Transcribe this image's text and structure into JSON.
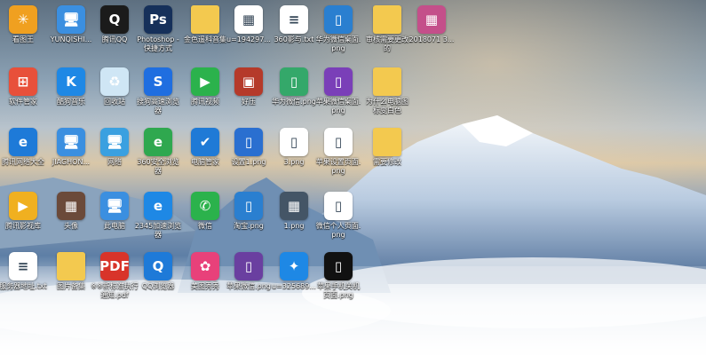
{
  "desktop": {
    "icons": [
      {
        "label": "看图王",
        "glyph": "✳",
        "color": "#f0a020",
        "icon": "kantu-icon"
      },
      {
        "label": "YUNQISHI...",
        "glyph": "🖥",
        "color": "#3b8fe0",
        "icon": "computer-icon"
      },
      {
        "label": "腾讯QQ",
        "glyph": "Q",
        "color": "#1b1b1b",
        "icon": "qq-icon"
      },
      {
        "label": "Photoshop - 快捷方式",
        "glyph": "Ps",
        "color": "#16305a",
        "icon": "photoshop-icon"
      },
      {
        "label": "金色遥科音集",
        "glyph": "",
        "color": "#f3c94f",
        "icon": "folder-icon"
      },
      {
        "label": "u=194297...",
        "glyph": "▦",
        "color": "#ffffff",
        "icon": "image-file-icon"
      },
      {
        "label": "360影与.txt",
        "glyph": "≡",
        "color": "#ffffff",
        "icon": "text-file-icon"
      },
      {
        "label": "华为微信桌面.png",
        "glyph": "▯",
        "color": "#2a7fd0",
        "icon": "phone-image-icon"
      },
      {
        "label": "审核需要更改的",
        "glyph": "",
        "color": "#f3c94f",
        "icon": "folder-icon"
      },
      {
        "label": "2018071 3...",
        "glyph": "▦",
        "color": "#c44f8a",
        "icon": "image-file-icon"
      },
      {
        "label": "软件管家",
        "glyph": "⊞",
        "color": "#e8503a",
        "icon": "software-manager-icon"
      },
      {
        "label": "酷狗音乐",
        "glyph": "K",
        "color": "#1e88e5",
        "icon": "kugou-icon"
      },
      {
        "label": "回收站",
        "glyph": "♻",
        "color": "#cfe6f5",
        "icon": "recycle-bin-icon"
      },
      {
        "label": "搜狗高速浏览器",
        "glyph": "S",
        "color": "#1f6ee0",
        "icon": "sogou-browser-icon"
      },
      {
        "label": "腾讯视频",
        "glyph": "▶",
        "color": "#2bb24c",
        "icon": "tencent-video-icon"
      },
      {
        "label": "好压",
        "glyph": "▣",
        "color": "#b53a2a",
        "icon": "haozip-icon"
      },
      {
        "label": "华为微信.png",
        "glyph": "▯",
        "color": "#34a86a",
        "icon": "phone-image-icon"
      },
      {
        "label": "苹果微信桌面.png",
        "glyph": "▯",
        "color": "#7a3fb8",
        "icon": "phone-image-icon"
      },
      {
        "label": "为什么电脑图标变白色",
        "glyph": "",
        "color": "#f3c94f",
        "icon": "folder-icon"
      },
      {
        "label": "腾讯网络大全",
        "glyph": "e",
        "color": "#1e7ad8",
        "icon": "ie-icon"
      },
      {
        "label": "JIAGHON...",
        "glyph": "🖥",
        "color": "#3b8fe0",
        "icon": "computer-icon"
      },
      {
        "label": "网络",
        "glyph": "🖥",
        "color": "#3aa0e0",
        "icon": "network-icon"
      },
      {
        "label": "360安全浏览器",
        "glyph": "e",
        "color": "#2fa84f",
        "icon": "360-browser-icon"
      },
      {
        "label": "电脑管家",
        "glyph": "✔",
        "color": "#1f7ad6",
        "icon": "pc-manager-icon"
      },
      {
        "label": "设置1.png",
        "glyph": "▯",
        "color": "#2a6fd0",
        "icon": "phone-image-icon"
      },
      {
        "label": "3.png",
        "glyph": "▯",
        "color": "#ffffff",
        "icon": "phone-image-icon"
      },
      {
        "label": "苹果设置页面.png",
        "glyph": "▯",
        "color": "#ffffff",
        "icon": "phone-image-icon"
      },
      {
        "label": "需要修改",
        "glyph": "",
        "color": "#f3c94f",
        "icon": "folder-icon"
      },
      {
        "label": "腾讯影视库",
        "glyph": "▶",
        "color": "#f0b020",
        "icon": "tencent-video-library-icon"
      },
      {
        "label": "头像",
        "glyph": "▦",
        "color": "#6b4a3a",
        "icon": "image-file-icon"
      },
      {
        "label": "此电脑",
        "glyph": "🖥",
        "color": "#3b8fe0",
        "icon": "this-pc-icon"
      },
      {
        "label": "2345加速浏览器",
        "glyph": "e",
        "color": "#1e88e5",
        "icon": "2345-browser-icon"
      },
      {
        "label": "微信",
        "glyph": "✆",
        "color": "#2bb24c",
        "icon": "wechat-icon"
      },
      {
        "label": "淘宝.png",
        "glyph": "▯",
        "color": "#2a7fd0",
        "icon": "phone-image-icon"
      },
      {
        "label": "1.png",
        "glyph": "▦",
        "color": "#456",
        "icon": "image-file-icon"
      },
      {
        "label": "微信个人页面.png",
        "glyph": "▯",
        "color": "#ffffff",
        "icon": "phone-image-icon"
      },
      {
        "label": "服务器地址.txt",
        "glyph": "≡",
        "color": "#ffffff",
        "icon": "text-file-icon"
      },
      {
        "label": "图片备集",
        "glyph": "",
        "color": "#f3c94f",
        "icon": "folder-icon"
      },
      {
        "label": "※※新标准执行通知.pdf",
        "glyph": "PDF",
        "color": "#d8342a",
        "icon": "pdf-icon"
      },
      {
        "label": "QQ浏览器",
        "glyph": "Q",
        "color": "#1e7ad8",
        "icon": "qq-browser-icon"
      },
      {
        "label": "美图秀秀",
        "glyph": "✿",
        "color": "#e8417a",
        "icon": "meitu-icon"
      },
      {
        "label": "苹果微信.png",
        "glyph": "▯",
        "color": "#6a3fa0",
        "icon": "phone-image-icon"
      },
      {
        "label": "u=325689...",
        "glyph": "✦",
        "color": "#1e88e5",
        "icon": "image-file-icon"
      },
      {
        "label": "苹果手机关机页面.png",
        "glyph": "▯",
        "color": "#111111",
        "icon": "phone-image-icon"
      }
    ]
  }
}
